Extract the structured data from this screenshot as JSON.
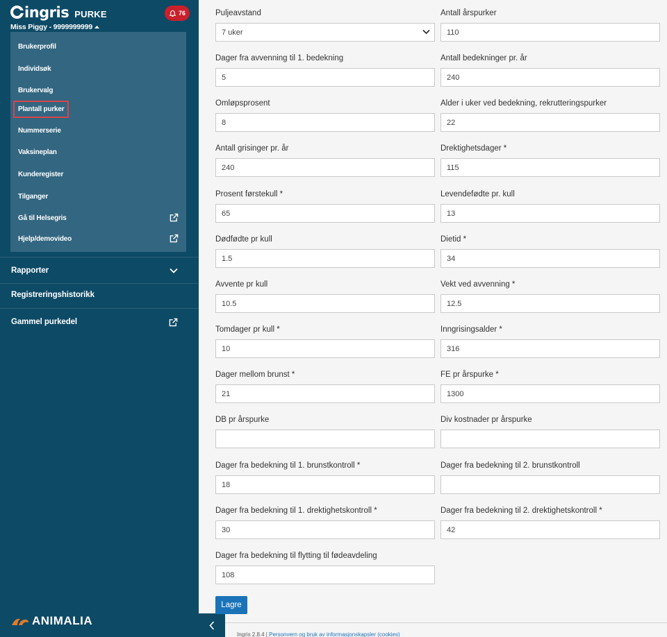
{
  "app": {
    "logo_text": "ingris",
    "logo_sub": "PURKE",
    "notification_count": "76",
    "user_label": "Miss Piggy - 9999999999"
  },
  "dropdown": {
    "items": [
      {
        "label": "Brukerprofil",
        "external": false
      },
      {
        "label": "Individsøk",
        "external": false
      },
      {
        "label": "Brukervalg",
        "external": false
      },
      {
        "label": "Plantall purker",
        "external": false,
        "highlighted": true
      },
      {
        "label": "Nummerserie",
        "external": false
      },
      {
        "label": "Vaksineplan",
        "external": false
      },
      {
        "label": "Kunderegister",
        "external": false
      },
      {
        "label": "Tilganger",
        "external": false
      },
      {
        "label": "Gå til Helsegris",
        "external": true
      },
      {
        "label": "Hjelp/demovideo",
        "external": true
      }
    ]
  },
  "nav": {
    "rapporter": "Rapporter",
    "registreringshistorikk": "Registreringshistorikk",
    "gammel_purkedel": "Gammel purkedel"
  },
  "brand_footer": "ANIMALIA",
  "form": {
    "fields": [
      {
        "label": "Puljeavstand",
        "value": "7 uker",
        "type": "select"
      },
      {
        "label": "Antall årspurker",
        "value": "110"
      },
      {
        "label": "Dager fra avvenning til 1. bedekning",
        "value": "5"
      },
      {
        "label": "Antall bedekninger pr. år",
        "value": "240"
      },
      {
        "label": "Omløpsprosent",
        "value": "8"
      },
      {
        "label": "Alder i uker ved bedekning, rekrutteringspurker",
        "value": "22"
      },
      {
        "label": "Antall grisinger pr. år",
        "value": "240"
      },
      {
        "label": "Drektighetsdager *",
        "value": "115"
      },
      {
        "label": "Prosent førstekull *",
        "value": "65"
      },
      {
        "label": "Levendefødte pr. kull",
        "value": "13"
      },
      {
        "label": "Dødfødte pr kull",
        "value": "1.5"
      },
      {
        "label": "Dietid *",
        "value": "34"
      },
      {
        "label": "Avvente pr kull",
        "value": "10.5"
      },
      {
        "label": "Vekt ved avvenning *",
        "value": "12.5"
      },
      {
        "label": "Tomdager pr kull *",
        "value": "10"
      },
      {
        "label": "Inngrisingsalder *",
        "value": "316"
      },
      {
        "label": "Dager mellom brunst *",
        "value": "21"
      },
      {
        "label": "FE pr årspurke *",
        "value": "1300"
      },
      {
        "label": "DB pr årspurke",
        "value": ""
      },
      {
        "label": "Div kostnader pr årspurke",
        "value": ""
      },
      {
        "label": "Dager fra bedekning til 1. brunstkontroll *",
        "value": "18"
      },
      {
        "label": "Dager fra bedekning til 2. brunstkontroll",
        "value": ""
      },
      {
        "label": "Dager fra bedekning til 1. drektighetskontroll *",
        "value": "30"
      },
      {
        "label": "Dager fra bedekning til 2. drektighetskontroll *",
        "value": "42"
      },
      {
        "label": "Dager fra bedekning til flytting til fødeavdeling",
        "value": "108"
      }
    ],
    "save_label": "Lagre"
  },
  "footer": {
    "version": "Ingris 2.8.4 |",
    "link": "Personvern og bruk av informasjonskapsler (cookies)"
  },
  "colors": {
    "sidebar": "#0d4a66",
    "dropdown": "#336680",
    "accent_red": "#c9202c",
    "primary_button": "#1a73b8"
  }
}
